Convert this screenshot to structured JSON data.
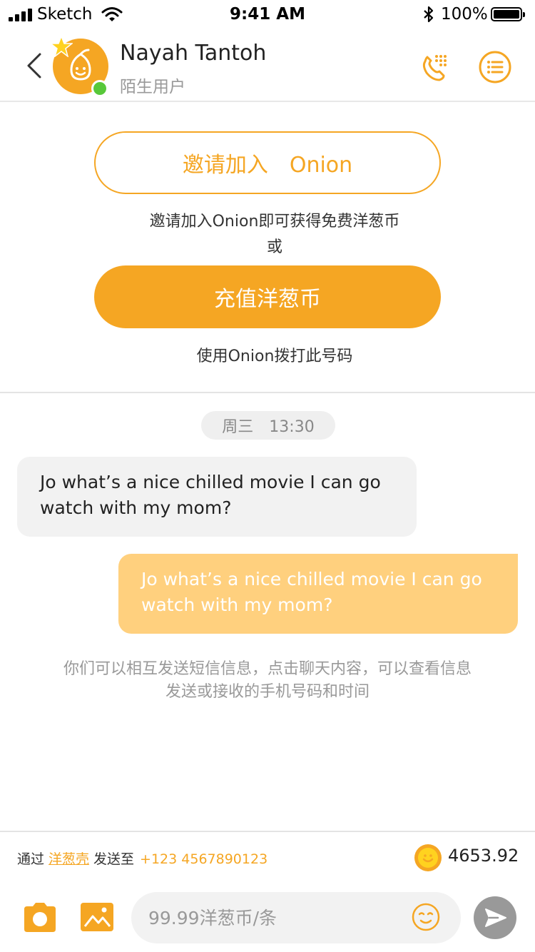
{
  "status_bar": {
    "carrier": "Sketch",
    "time": "9:41 AM",
    "battery": "100%"
  },
  "header": {
    "name": "Nayah Tantoh",
    "subtitle": "陌生用户",
    "icons": [
      "back-arrow-icon",
      "avatar",
      "star-badge-icon",
      "dialpad-icon",
      "list-menu-icon"
    ],
    "online_color": "#58c83a"
  },
  "actions": {
    "invite_label": "邀请加入　Onion",
    "invite_desc": "邀请加入Onion即可获得免费洋葱币",
    "or": "或",
    "recharge_label": "充值洋葱币",
    "call_desc": "使用Onion拨打此号码"
  },
  "chat": {
    "timestamp": "周三　13:30",
    "messages": [
      {
        "direction": "incoming",
        "text": "Jo what’s a nice chilled movie I can go watch with my mom?"
      },
      {
        "direction": "outgoing",
        "text": "Jo what’s a nice chilled movie I can go watch with my mom?"
      }
    ],
    "hint": "你们可以相互发送短信信息，点击聊天内容，可以查看信息发送或接收的手机号码和时间"
  },
  "bottom": {
    "via_prefix": "通过",
    "via_link": "洋葱壳",
    "via_mid": "发送至",
    "phone": "+123 4567890123",
    "balance": "4653.92",
    "input_placeholder": "99.99洋葱币/条"
  },
  "colors": {
    "accent": "#f5a623",
    "outgoing_bubble": "#ffd07e",
    "incoming_bubble": "#f2f2f2",
    "send_button": "#999999"
  }
}
